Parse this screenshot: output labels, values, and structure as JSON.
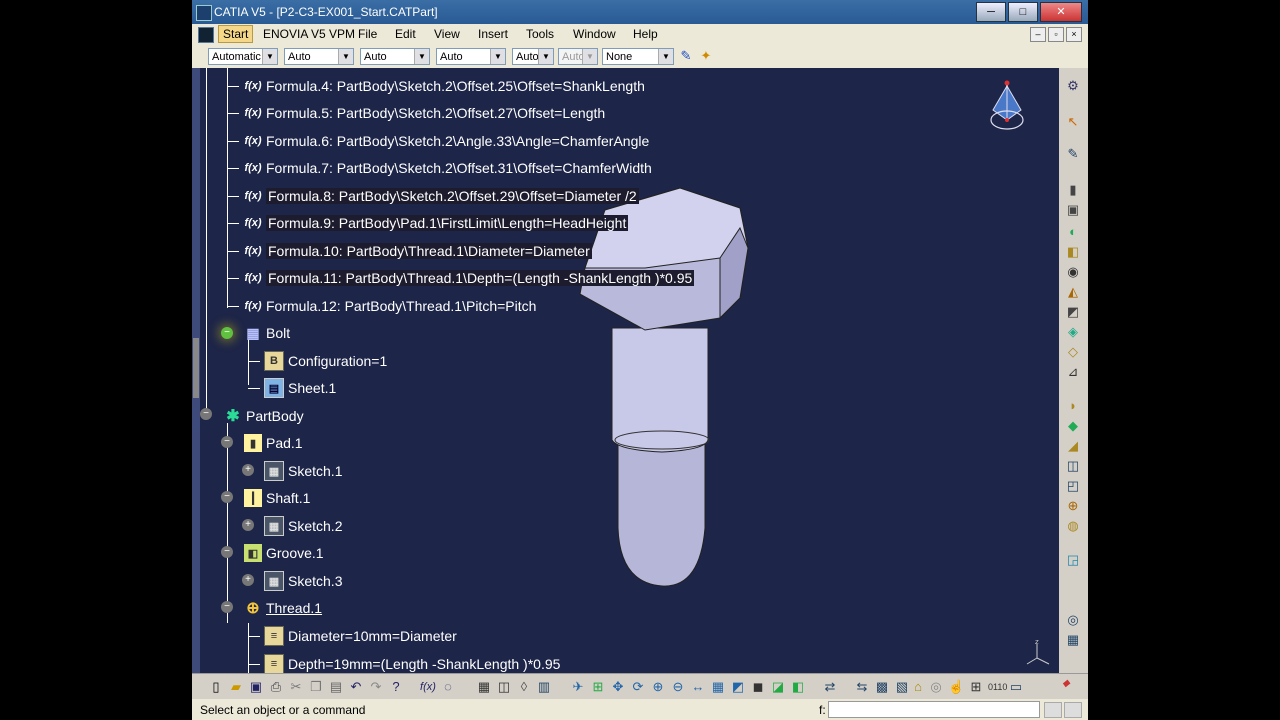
{
  "window": {
    "title": "CATIA V5 - [P2-C3-EX001_Start.CATPart]",
    "buttons": [
      "─",
      "□",
      "✕"
    ]
  },
  "menu": {
    "items": [
      "Start",
      "ENOVIA V5 VPM",
      "File",
      "Edit",
      "View",
      "Insert",
      "Tools",
      "Window",
      "Help"
    ],
    "mdi_buttons": [
      "–",
      "▫",
      "×"
    ]
  },
  "propbar": {
    "combos": [
      "Automatic",
      "Auto",
      "Auto",
      "Auto",
      "Auto",
      "Auto",
      "None"
    ]
  },
  "tree": {
    "formulas": [
      "Formula.4: PartBody\\Sketch.2\\Offset.25\\Offset=ShankLength",
      "Formula.5: PartBody\\Sketch.2\\Offset.27\\Offset=Length",
      "Formula.6: PartBody\\Sketch.2\\Angle.33\\Angle=ChamferAngle",
      "Formula.7: PartBody\\Sketch.2\\Offset.31\\Offset=ChamferWidth",
      "Formula.8: PartBody\\Sketch.2\\Offset.29\\Offset=Diameter /2",
      "Formula.9: PartBody\\Pad.1\\FirstLimit\\Length=HeadHeight",
      "Formula.10: PartBody\\Thread.1\\Diameter=Diameter",
      "Formula.11: PartBody\\Thread.1\\Depth=(Length -ShankLength )*0.95",
      "Formula.12: PartBody\\Thread.1\\Pitch=Pitch"
    ],
    "bolt": "Bolt",
    "configuration": "Configuration=1",
    "sheet": "Sheet.1",
    "partbody": "PartBody",
    "pad": "Pad.1",
    "sketch1": "Sketch.1",
    "shaft": "Shaft.1",
    "sketch2": "Sketch.2",
    "groove": "Groove.1",
    "sketch3": "Sketch.3",
    "thread": "Thread.1",
    "thread_diameter": "Diameter=10mm=Diameter",
    "thread_depth": "Depth=19mm=(Length -ShankLength )*0.95"
  },
  "icons": {
    "formula": "f(x)",
    "table": "▦",
    "gear": "✱",
    "thread": "⊕"
  },
  "compass_axis": "z",
  "status": {
    "message": "Select an object or a command",
    "f_label": "f:"
  },
  "colors": {
    "viewport_bg": "#1d2548",
    "title_bar": "#2a5a94",
    "active_menu": "#f5d78a",
    "tree_text": "#ffffff",
    "bolt_fill": "#c8c8e8"
  }
}
